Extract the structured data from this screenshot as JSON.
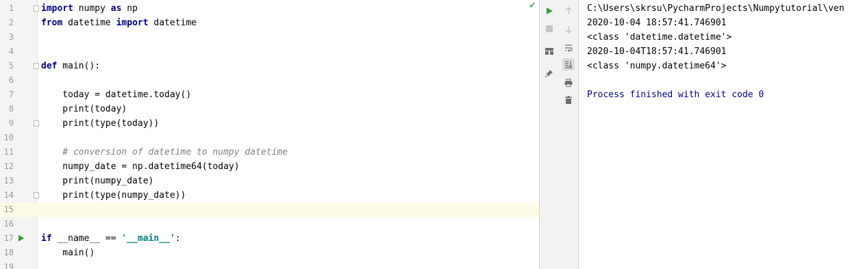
{
  "editor": {
    "lines": [
      {
        "num": "1",
        "tokens": [
          {
            "t": "import",
            "c": "kw"
          },
          {
            "t": " numpy ",
            "c": ""
          },
          {
            "t": "as",
            "c": "kw"
          },
          {
            "t": " np",
            "c": ""
          }
        ]
      },
      {
        "num": "2",
        "tokens": [
          {
            "t": "from",
            "c": "kw"
          },
          {
            "t": " datetime ",
            "c": ""
          },
          {
            "t": "import",
            "c": "kw"
          },
          {
            "t": " datetime",
            "c": ""
          }
        ]
      },
      {
        "num": "3",
        "tokens": []
      },
      {
        "num": "4",
        "tokens": []
      },
      {
        "num": "5",
        "tokens": [
          {
            "t": "def",
            "c": "kw"
          },
          {
            "t": " main():",
            "c": ""
          }
        ]
      },
      {
        "num": "6",
        "tokens": []
      },
      {
        "num": "7",
        "tokens": [
          {
            "t": "    today = datetime.today()",
            "c": ""
          }
        ]
      },
      {
        "num": "8",
        "tokens": [
          {
            "t": "    print(today)",
            "c": ""
          }
        ]
      },
      {
        "num": "9",
        "tokens": [
          {
            "t": "    print(type(today))",
            "c": ""
          }
        ]
      },
      {
        "num": "10",
        "tokens": []
      },
      {
        "num": "11",
        "tokens": [
          {
            "t": "    # conversion of datetime to numpy datetime",
            "c": "comment"
          }
        ]
      },
      {
        "num": "12",
        "tokens": [
          {
            "t": "    numpy_date = np.datetime64(today)",
            "c": ""
          }
        ]
      },
      {
        "num": "13",
        "tokens": [
          {
            "t": "    print(numpy_date)",
            "c": ""
          }
        ]
      },
      {
        "num": "14",
        "tokens": [
          {
            "t": "    print(type(numpy_date))",
            "c": ""
          }
        ]
      },
      {
        "num": "15",
        "tokens": []
      },
      {
        "num": "16",
        "tokens": []
      },
      {
        "num": "17",
        "tokens": [
          {
            "t": "if",
            "c": "kw"
          },
          {
            "t": " __name__ == ",
            "c": ""
          },
          {
            "t": "'__main__'",
            "c": "str"
          },
          {
            "t": ":",
            "c": ""
          }
        ]
      },
      {
        "num": "18",
        "tokens": [
          {
            "t": "    main()",
            "c": ""
          }
        ]
      },
      {
        "num": "19",
        "tokens": []
      }
    ],
    "current_line": "15"
  },
  "console": {
    "lines": [
      "C:\\Users\\skrsu\\PycharmProjects\\Numpytutorial\\ven",
      "2020-10-04 18:57:41.746901",
      "<class 'datetime.datetime'>",
      "2020-10-04T18:57:41.746901",
      "<class 'numpy.datetime64'>",
      "",
      "Process finished with exit code 0"
    ]
  },
  "icons": {
    "run": "run-icon",
    "stop": "stop-icon",
    "layout": "layout-icon",
    "pin": "pin-icon",
    "up": "arrow-up-icon",
    "down": "arrow-down-icon",
    "wrap": "soft-wrap-icon",
    "scroll": "scroll-to-end-icon",
    "print": "print-icon",
    "trash": "trash-icon",
    "check": "checkmark-icon"
  },
  "colors": {
    "keyword": "#000080",
    "comment": "#808080",
    "string": "#008080",
    "current_line": "#fdfae6",
    "run_green": "#3d9a3d"
  }
}
